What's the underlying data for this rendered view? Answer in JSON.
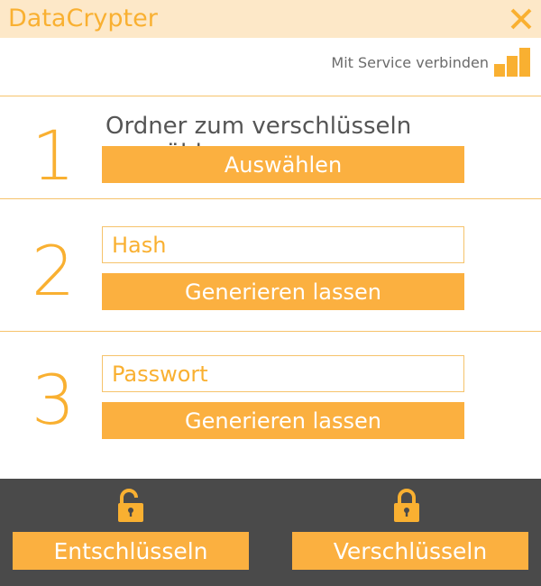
{
  "app": {
    "title": "DataCrypter"
  },
  "service": {
    "label": "Mit Service verbinden"
  },
  "steps": [
    {
      "number": "1",
      "heading": "Ordner zum verschlüsseln auswählen",
      "button_label": "Auswählen"
    },
    {
      "number": "2",
      "placeholder": "Hash",
      "value": "",
      "button_label": "Generieren lassen"
    },
    {
      "number": "3",
      "placeholder": "Passwort",
      "value": "",
      "button_label": "Generieren lassen"
    }
  ],
  "footer": {
    "decrypt_label": "Entschlüsseln",
    "encrypt_label": "Verschlüsseln"
  },
  "colors": {
    "accent": "#fbb040",
    "title_bar": "#fde8c8",
    "footer_bg": "#4a4a4a",
    "divider": "#f6c36b"
  },
  "icons": {
    "close": "close-icon",
    "signal": "signal-bars-icon",
    "lock": "unlocked-padlock-icon",
    "lock_closed": "locked-padlock-icon"
  }
}
